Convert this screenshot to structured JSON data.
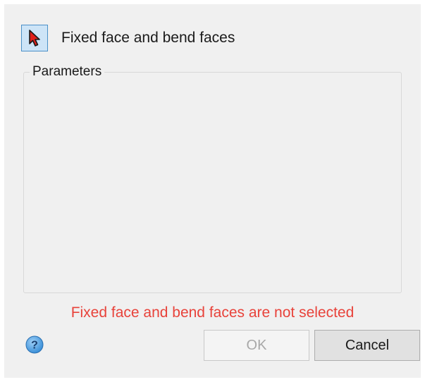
{
  "selector": {
    "label": "Fixed face and bend faces",
    "icon": "red-arrow-cursor-icon"
  },
  "parameters": {
    "legend": "Parameters"
  },
  "error": {
    "message": "Fixed face and bend faces are not selected",
    "color": "#e8423a"
  },
  "buttons": {
    "ok_label": "OK",
    "ok_enabled": false,
    "cancel_label": "Cancel"
  },
  "help": {
    "icon": "help-icon"
  },
  "colors": {
    "dialog_bg": "#f0f0f0",
    "selector_active_bg": "#cde4f7",
    "selector_active_border": "#4a90c8",
    "help_blue": "#3a8fd8"
  }
}
